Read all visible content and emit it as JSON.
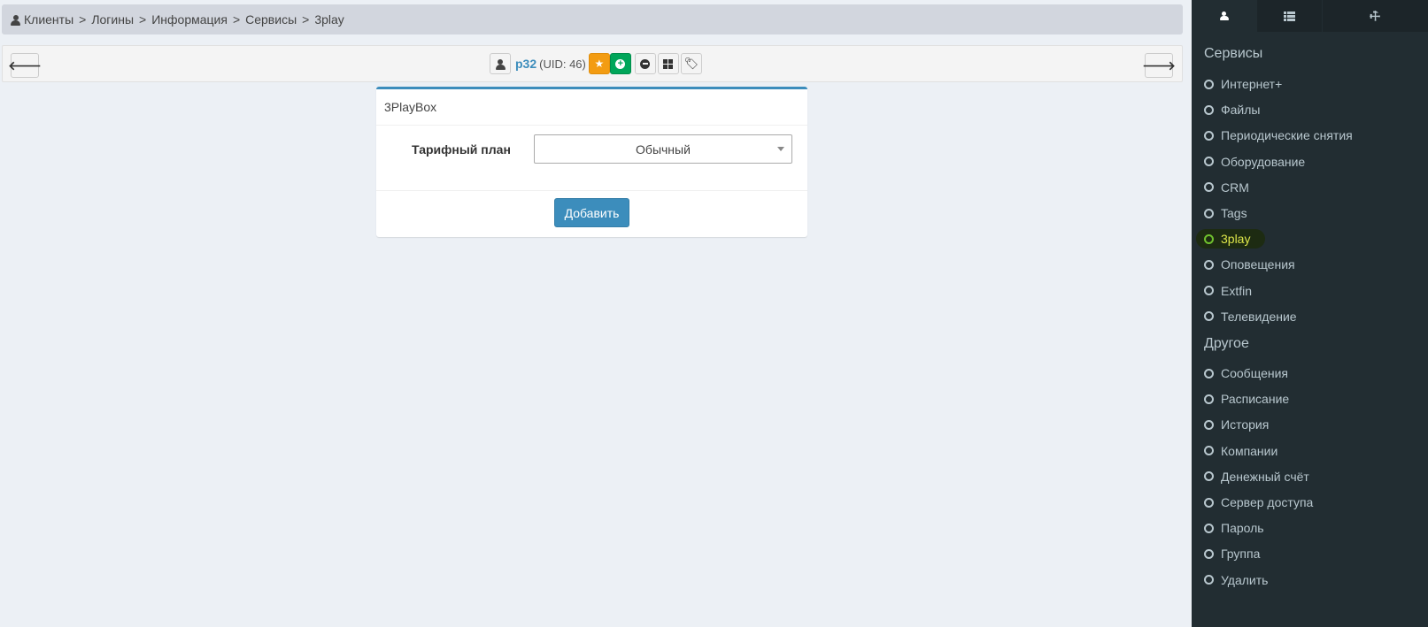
{
  "breadcrumb": {
    "items": [
      "Клиенты",
      "Логины",
      "Информация",
      "Сервисы",
      "3play"
    ],
    "separator": ">"
  },
  "toolbar": {
    "login": "p32",
    "uid": "(UID: 46)"
  },
  "panel": {
    "title": "3PlayBox",
    "tariff_label": "Тарифный план",
    "tariff_value": "Обычный",
    "add_button": "Добавить"
  },
  "sidebar": {
    "services_title": "Сервисы",
    "services": [
      "Интернет+",
      "Файлы",
      "Периодические снятия",
      "Оборудование",
      "CRM",
      "Tags",
      "3play",
      "Оповещения",
      "Extfin",
      "Телевидение"
    ],
    "other_title": "Другое",
    "other": [
      "Сообщения",
      "Расписание",
      "История",
      "Компании",
      "Денежный счёт",
      "Сервер доступа",
      "Пароль",
      "Группа",
      "Удалить"
    ]
  },
  "colors": {
    "accent": "#3c8dbc",
    "sidebar_bg": "#222d32",
    "star": "#f39c12",
    "plus": "#00a65a",
    "highlight_text": "#dde64a"
  }
}
